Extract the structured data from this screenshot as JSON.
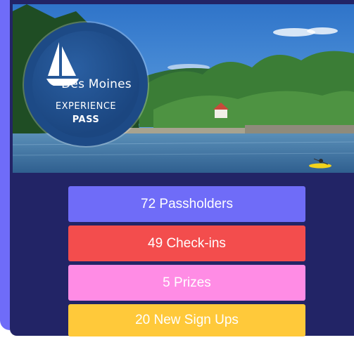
{
  "brand": {
    "logo_line1": "Des Moines",
    "logo_line2": "EXPERIENCE",
    "logo_line3": "PASS"
  },
  "colors": {
    "accent": "#6f6cf8",
    "card_background": "#222466",
    "passholders": "#6f6cf8",
    "checkins": "#f34d4d",
    "prizes": "#ff8ce5",
    "signups": "#ffc93a"
  },
  "stats": {
    "passholders": "72 Passholders",
    "checkins": "49 Check-ins",
    "prizes": "5 Prizes",
    "signups": "20 New Sign Ups"
  },
  "icons": {
    "logo": "sailboat-icon"
  }
}
